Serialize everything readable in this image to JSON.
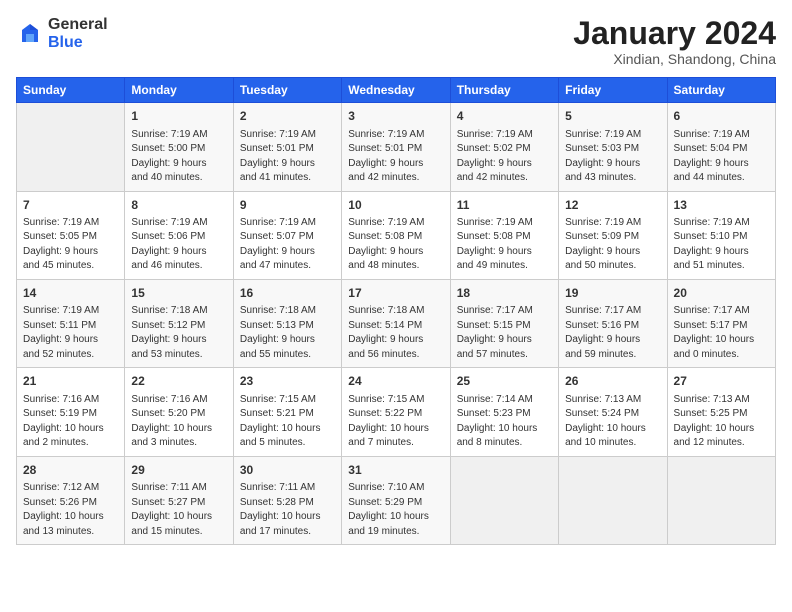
{
  "header": {
    "logo": {
      "general": "General",
      "blue": "Blue"
    },
    "title": "January 2024",
    "subtitle": "Xindian, Shandong, China"
  },
  "weekdays": [
    "Sunday",
    "Monday",
    "Tuesday",
    "Wednesday",
    "Thursday",
    "Friday",
    "Saturday"
  ],
  "weeks": [
    [
      {
        "day": null,
        "content": ""
      },
      {
        "day": "1",
        "content": "Sunrise: 7:19 AM\nSunset: 5:00 PM\nDaylight: 9 hours\nand 40 minutes."
      },
      {
        "day": "2",
        "content": "Sunrise: 7:19 AM\nSunset: 5:01 PM\nDaylight: 9 hours\nand 41 minutes."
      },
      {
        "day": "3",
        "content": "Sunrise: 7:19 AM\nSunset: 5:01 PM\nDaylight: 9 hours\nand 42 minutes."
      },
      {
        "day": "4",
        "content": "Sunrise: 7:19 AM\nSunset: 5:02 PM\nDaylight: 9 hours\nand 42 minutes."
      },
      {
        "day": "5",
        "content": "Sunrise: 7:19 AM\nSunset: 5:03 PM\nDaylight: 9 hours\nand 43 minutes."
      },
      {
        "day": "6",
        "content": "Sunrise: 7:19 AM\nSunset: 5:04 PM\nDaylight: 9 hours\nand 44 minutes."
      }
    ],
    [
      {
        "day": "7",
        "content": "Sunrise: 7:19 AM\nSunset: 5:05 PM\nDaylight: 9 hours\nand 45 minutes."
      },
      {
        "day": "8",
        "content": "Sunrise: 7:19 AM\nSunset: 5:06 PM\nDaylight: 9 hours\nand 46 minutes."
      },
      {
        "day": "9",
        "content": "Sunrise: 7:19 AM\nSunset: 5:07 PM\nDaylight: 9 hours\nand 47 minutes."
      },
      {
        "day": "10",
        "content": "Sunrise: 7:19 AM\nSunset: 5:08 PM\nDaylight: 9 hours\nand 48 minutes."
      },
      {
        "day": "11",
        "content": "Sunrise: 7:19 AM\nSunset: 5:08 PM\nDaylight: 9 hours\nand 49 minutes."
      },
      {
        "day": "12",
        "content": "Sunrise: 7:19 AM\nSunset: 5:09 PM\nDaylight: 9 hours\nand 50 minutes."
      },
      {
        "day": "13",
        "content": "Sunrise: 7:19 AM\nSunset: 5:10 PM\nDaylight: 9 hours\nand 51 minutes."
      }
    ],
    [
      {
        "day": "14",
        "content": "Sunrise: 7:19 AM\nSunset: 5:11 PM\nDaylight: 9 hours\nand 52 minutes."
      },
      {
        "day": "15",
        "content": "Sunrise: 7:18 AM\nSunset: 5:12 PM\nDaylight: 9 hours\nand 53 minutes."
      },
      {
        "day": "16",
        "content": "Sunrise: 7:18 AM\nSunset: 5:13 PM\nDaylight: 9 hours\nand 55 minutes."
      },
      {
        "day": "17",
        "content": "Sunrise: 7:18 AM\nSunset: 5:14 PM\nDaylight: 9 hours\nand 56 minutes."
      },
      {
        "day": "18",
        "content": "Sunrise: 7:17 AM\nSunset: 5:15 PM\nDaylight: 9 hours\nand 57 minutes."
      },
      {
        "day": "19",
        "content": "Sunrise: 7:17 AM\nSunset: 5:16 PM\nDaylight: 9 hours\nand 59 minutes."
      },
      {
        "day": "20",
        "content": "Sunrise: 7:17 AM\nSunset: 5:17 PM\nDaylight: 10 hours\nand 0 minutes."
      }
    ],
    [
      {
        "day": "21",
        "content": "Sunrise: 7:16 AM\nSunset: 5:19 PM\nDaylight: 10 hours\nand 2 minutes."
      },
      {
        "day": "22",
        "content": "Sunrise: 7:16 AM\nSunset: 5:20 PM\nDaylight: 10 hours\nand 3 minutes."
      },
      {
        "day": "23",
        "content": "Sunrise: 7:15 AM\nSunset: 5:21 PM\nDaylight: 10 hours\nand 5 minutes."
      },
      {
        "day": "24",
        "content": "Sunrise: 7:15 AM\nSunset: 5:22 PM\nDaylight: 10 hours\nand 7 minutes."
      },
      {
        "day": "25",
        "content": "Sunrise: 7:14 AM\nSunset: 5:23 PM\nDaylight: 10 hours\nand 8 minutes."
      },
      {
        "day": "26",
        "content": "Sunrise: 7:13 AM\nSunset: 5:24 PM\nDaylight: 10 hours\nand 10 minutes."
      },
      {
        "day": "27",
        "content": "Sunrise: 7:13 AM\nSunset: 5:25 PM\nDaylight: 10 hours\nand 12 minutes."
      }
    ],
    [
      {
        "day": "28",
        "content": "Sunrise: 7:12 AM\nSunset: 5:26 PM\nDaylight: 10 hours\nand 13 minutes."
      },
      {
        "day": "29",
        "content": "Sunrise: 7:11 AM\nSunset: 5:27 PM\nDaylight: 10 hours\nand 15 minutes."
      },
      {
        "day": "30",
        "content": "Sunrise: 7:11 AM\nSunset: 5:28 PM\nDaylight: 10 hours\nand 17 minutes."
      },
      {
        "day": "31",
        "content": "Sunrise: 7:10 AM\nSunset: 5:29 PM\nDaylight: 10 hours\nand 19 minutes."
      },
      {
        "day": null,
        "content": ""
      },
      {
        "day": null,
        "content": ""
      },
      {
        "day": null,
        "content": ""
      }
    ]
  ]
}
